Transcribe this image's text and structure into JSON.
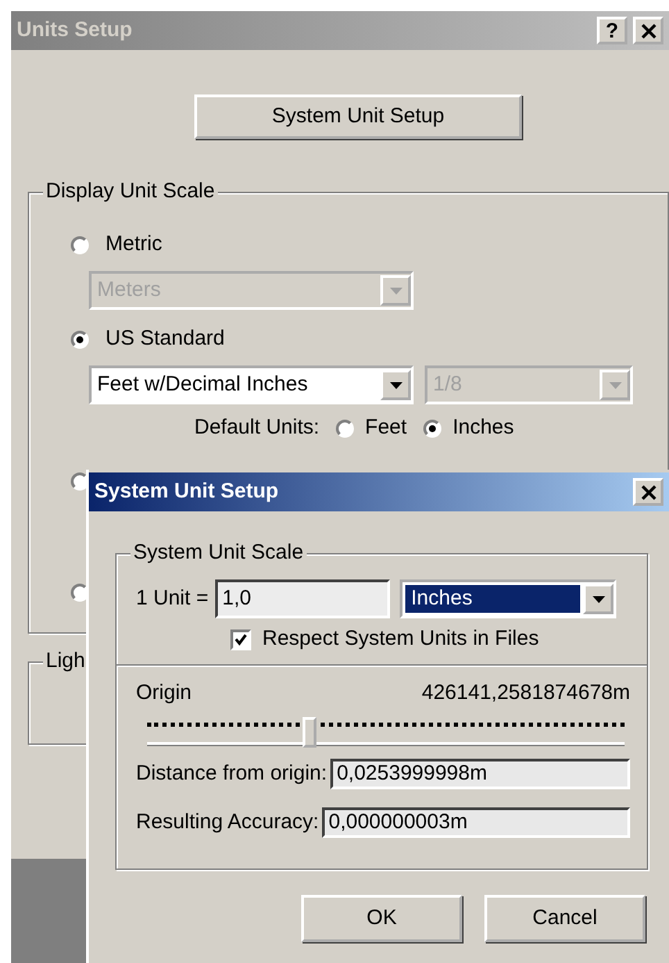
{
  "units_window": {
    "title": "Units Setup",
    "help_button": "?",
    "system_unit_setup_button": "System Unit Setup",
    "display_unit_scale": {
      "title": "Display Unit Scale",
      "options": [
        {
          "label": "Metric",
          "selected": false,
          "combos": [
            {
              "value": "Meters",
              "disabled": true
            }
          ]
        },
        {
          "label": "US Standard",
          "selected": true,
          "combos": [
            {
              "value": "Feet w/Decimal Inches",
              "disabled": false
            },
            {
              "value": "1/8",
              "disabled": true
            }
          ],
          "default_units": {
            "label": "Default Units:",
            "choices": [
              {
                "label": "Feet",
                "selected": false
              },
              {
                "label": "Inches",
                "selected": true
              }
            ]
          }
        },
        {
          "selected": false
        },
        {
          "selected": false
        }
      ]
    },
    "lighting_group": {
      "title": "Ligh"
    }
  },
  "dialog": {
    "title": "System Unit Setup",
    "group_title": "System Unit Scale",
    "unit_label": "1 Unit =",
    "unit_value": "1,0",
    "unit_type": {
      "value": "Inches",
      "selected": true
    },
    "respect_option": {
      "label": "Respect System Units in Files",
      "checked": true
    },
    "origin": {
      "label": "Origin",
      "reading": "426141,2581874678m",
      "level": 0.34
    },
    "fields": [
      {
        "label": "Distance from origin:",
        "value": "0,0253999998m"
      },
      {
        "label": "Resulting Accuracy:",
        "value": "0,000000003m"
      }
    ],
    "buttons": [
      "OK",
      "Cancel"
    ]
  }
}
